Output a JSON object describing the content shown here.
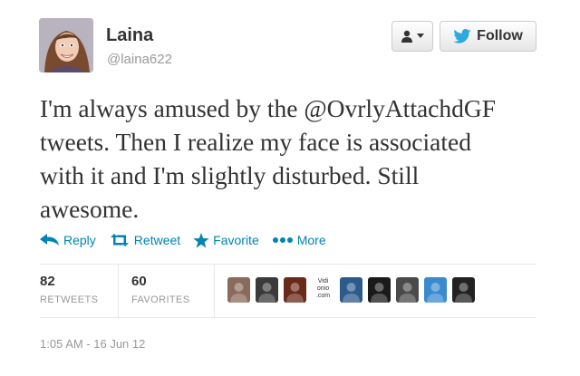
{
  "user": {
    "name": "Laina",
    "handle": "@laina622"
  },
  "follow_button": {
    "label": "Follow"
  },
  "tweet": {
    "lines": [
      "I'm always amused by the @OvrlyAttachdGF",
      "tweets. Then I realize my face is associated",
      "with it and I'm slightly disturbed. Still",
      "awesome."
    ]
  },
  "actions": {
    "reply": "Reply",
    "retweet": "Retweet",
    "favorite": "Favorite",
    "more": "More"
  },
  "stats": {
    "retweets_count": "82",
    "retweets_label": "RETWEETS",
    "favorites_count": "60",
    "favorites_label": "FAVORITES"
  },
  "favoriters": [
    {
      "icon": "avatar-image-icon",
      "color": "#8a6a5a"
    },
    {
      "icon": "avatar-image-icon",
      "color": "#3a3a3a"
    },
    {
      "icon": "avatar-image-icon",
      "color": "#6a2a1a"
    },
    {
      "text": "Vidi onio .com"
    },
    {
      "icon": "avatar-image-icon",
      "color": "#2c5a8a"
    },
    {
      "icon": "avatar-image-icon",
      "color": "#1a1a1a"
    },
    {
      "icon": "avatar-image-icon",
      "color": "#4a4a4a"
    },
    {
      "icon": "avatar-image-icon",
      "color": "#3a8ad0"
    },
    {
      "icon": "avatar-image-icon",
      "color": "#222222"
    }
  ],
  "timestamp": "1:05 AM - 16 Jun 12",
  "colors": {
    "link": "#0084b4",
    "twitter_bird": "#2ba9e1",
    "muted": "#999999"
  }
}
